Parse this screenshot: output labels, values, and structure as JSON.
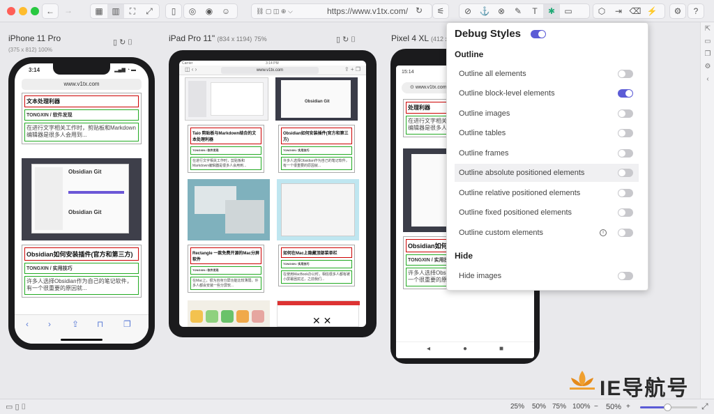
{
  "toolbar": {
    "url": "https://www.v1tx.com/"
  },
  "devices": [
    {
      "name": "iPhone 11 Pro",
      "dims": "(375 x 812)",
      "zoom": "100%"
    },
    {
      "name": "iPad Pro 11\"",
      "dims": "(834 x 1194)",
      "zoom": "75%"
    },
    {
      "name": "Pixel 4 XL",
      "dims": "(412 x"
    }
  ],
  "iphone": {
    "time": "3:14",
    "address": "www.v1tx.com",
    "partial_title": "文本处理利器",
    "tag1": "TONGXIN  /  软件发现",
    "excerpt1": "在进行文字相关工作时，剪贴板和Markdown编辑器是很多人会用到...",
    "thumb_title": "Obsidian Git",
    "thumb_title2": "Obsidian Git",
    "card2_title": "Obsidian如何安装插件(官方和第三方)",
    "tag2": "TONGXIN  /  实用技巧",
    "excerpt2": "许多人选择Obsidian作为自己的笔记软件，有一个很重要的原因就..."
  },
  "ipad": {
    "carrier": "Carrier",
    "time": "3:14 PM",
    "address": "www.v1tx.com",
    "c1_title": "Taio 剪贴板与Markdown结合的文本处理利器",
    "c1_tag": "TONGXIN  /  软件发现",
    "c1_excerpt": "在进行文字相关工作时，剪贴板和Markdown编辑器是很多人会用到...",
    "c2_title": "Obsidian如何安装插件(官方和第三方)",
    "c2_tag": "TONGXIN  /  实用技巧",
    "c2_excerpt": "许多人选择Obsidian作为自己的笔记软件，有一个很重要的原因就...",
    "c3_title": "Rectangle 一款免费开源的Mac分屏软件",
    "c3_tag": "TONGXIN  /  软件发现",
    "c3_excerpt": "在Mac上，很为自身分屏功能比较薄弱，许多人都会安装一些分屏软...",
    "c4_title": "如何在Mac上隐藏顶部菜单栏",
    "c4_tag": "TONGXIN  /  实用技巧",
    "c4_excerpt": "在使用MacBook办公时，相信很多人都有被小屏幕困扰过，之前我们..."
  },
  "pixel": {
    "time": "15:14",
    "address": "www.v1tx.com",
    "partial_title": "处理利器",
    "excerpt1": "在进行文字相关工作时，剪贴板和Markdown编辑器是很多人",
    "card2_title": "Obsidian如何安装插件(官方和第三方)",
    "tag2": "TONGXIN  /  实用技巧",
    "excerpt2": "许多人选择Obsidian作为自己的笔记软件，有一个很重要的原因就..."
  },
  "panel": {
    "title": "Debug Styles",
    "section_outline": "Outline",
    "section_hide": "Hide",
    "rows": [
      {
        "label": "Outline all elements",
        "on": false
      },
      {
        "label": "Outline block-level elements",
        "on": true
      },
      {
        "label": "Outline images",
        "on": false
      },
      {
        "label": "Outline tables",
        "on": false
      },
      {
        "label": "Outline frames",
        "on": false
      },
      {
        "label": "Outline absolute positioned elements",
        "on": false
      },
      {
        "label": "Outline relative positioned elements",
        "on": false
      },
      {
        "label": "Outline fixed positioned elements",
        "on": false
      },
      {
        "label": "Outline custom elements",
        "on": false
      }
    ],
    "hide_rows": [
      {
        "label": "Hide images",
        "on": false
      }
    ]
  },
  "bottom": {
    "zooms": [
      "25%",
      "50%",
      "75%",
      "100%"
    ],
    "minus": "−",
    "current": "50%",
    "plus": "+"
  },
  "watermark": {
    "text": "IE导航号"
  },
  "colors": {
    "accent": "#5b5bd6",
    "tag_border": "#22aa22",
    "title_border": "#cc0000"
  }
}
